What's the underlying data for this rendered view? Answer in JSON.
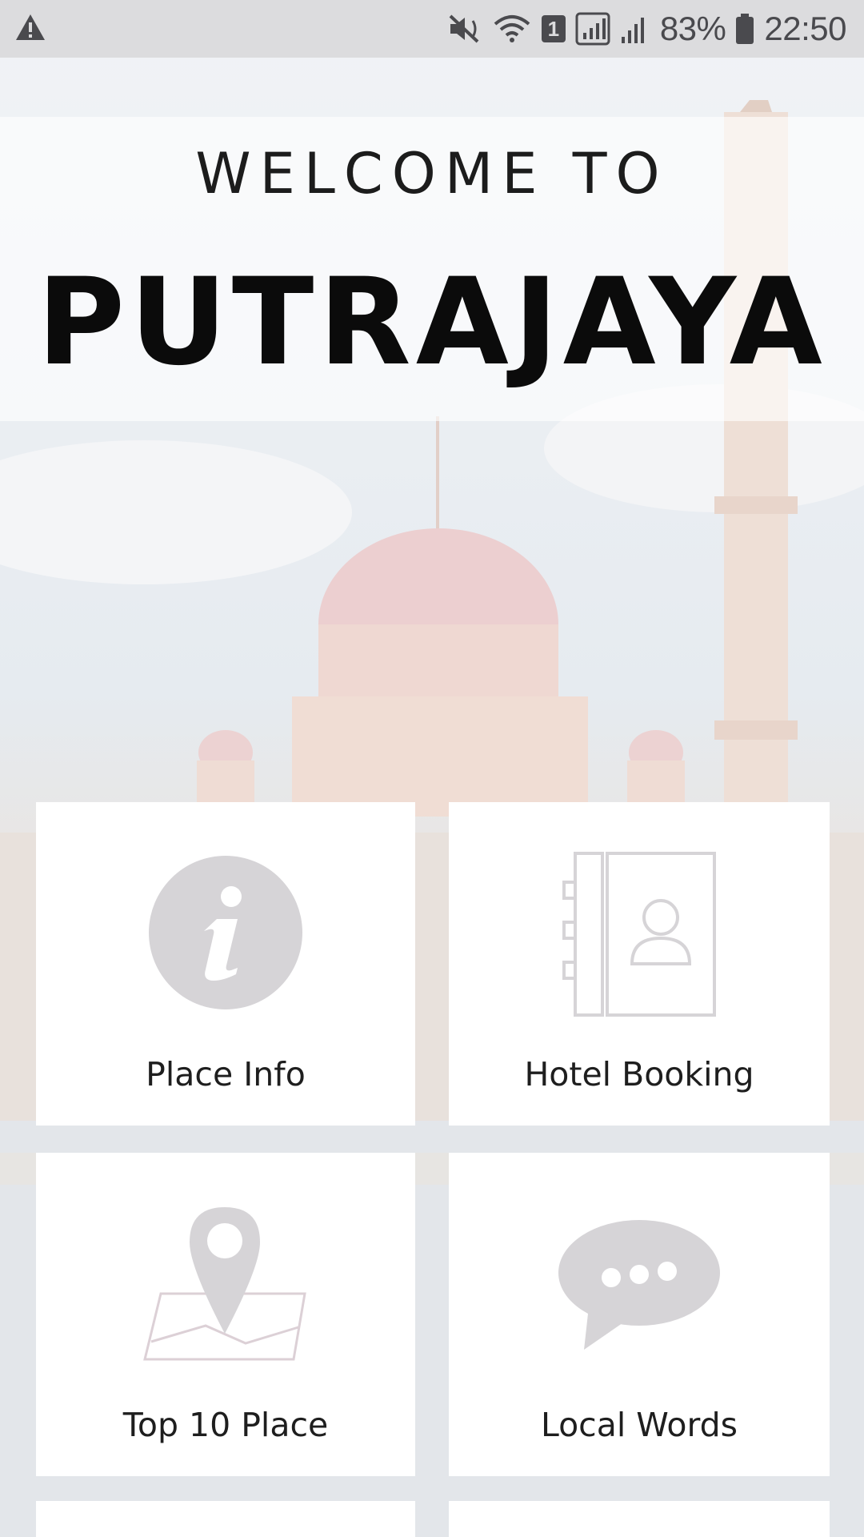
{
  "status_bar": {
    "sim_slot": "1",
    "battery": "83%",
    "time": "22:50"
  },
  "header": {
    "welcome": "WELCOME TO",
    "city": "PUTRAJAYA"
  },
  "menu": [
    {
      "label": "Place Info",
      "icon": "info-icon"
    },
    {
      "label": "Hotel Booking",
      "icon": "contact-book-icon"
    },
    {
      "label": "Top 10 Place",
      "icon": "map-pin-icon"
    },
    {
      "label": "Local Words",
      "icon": "chat-bubble-icon"
    }
  ],
  "colors": {
    "status_bar_bg": "#dcdcde",
    "tile_bg": "#ffffff",
    "icon_gray": "#d6d4d7",
    "text_dark": "#1e1e1e"
  }
}
